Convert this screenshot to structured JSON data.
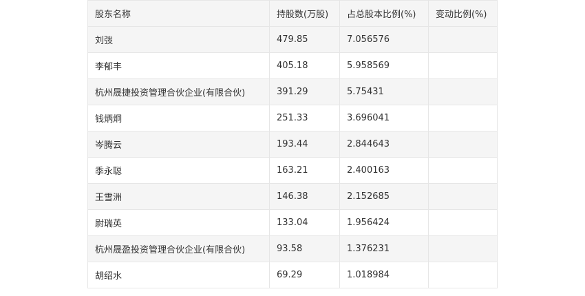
{
  "table": {
    "headers": [
      "股东名称",
      "持股数(万股)",
      "占总股本比例(%)",
      "变动比例(%)"
    ],
    "rows": [
      [
        "刘弢",
        "479.85",
        "7.056576",
        ""
      ],
      [
        "李郁丰",
        "405.18",
        "5.958569",
        ""
      ],
      [
        "杭州晟捷投资管理合伙企业(有限合伙)",
        "391.29",
        "5.75431",
        ""
      ],
      [
        "钱炳炯",
        "251.33",
        "3.696041",
        ""
      ],
      [
        "岑腾云",
        "193.44",
        "2.844643",
        ""
      ],
      [
        "季永聪",
        "163.21",
        "2.400163",
        ""
      ],
      [
        "王雪洲",
        "146.38",
        "2.152685",
        ""
      ],
      [
        "尉瑞英",
        "133.04",
        "1.956424",
        ""
      ],
      [
        "杭州晟盈投资管理合伙企业(有限合伙)",
        "93.58",
        "1.376231",
        ""
      ],
      [
        "胡绍水",
        "69.29",
        "1.018984",
        ""
      ]
    ]
  }
}
